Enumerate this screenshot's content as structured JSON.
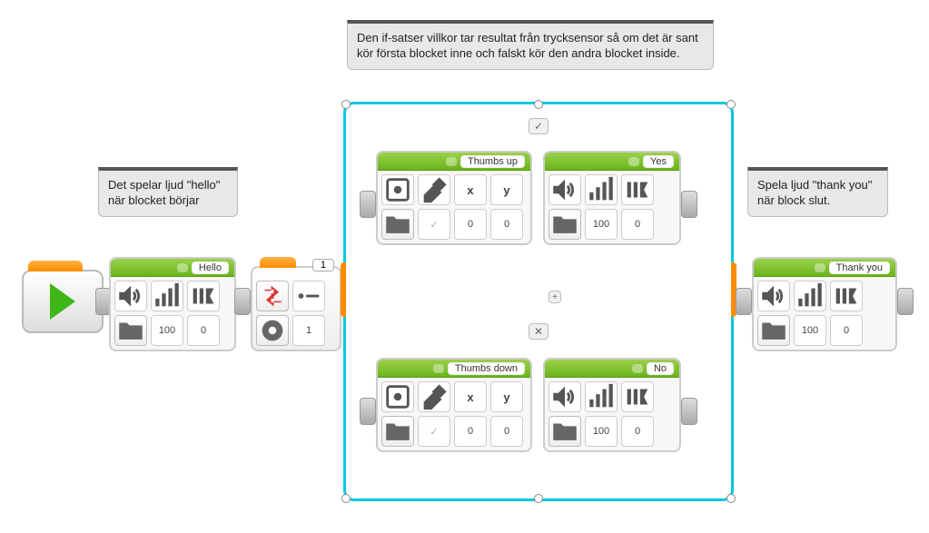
{
  "comments": {
    "left": "Det spelar ljud \"hello\" när blocket börjar",
    "top": "Den if-satser villkor tar resultat från trycksensor så om det är sant kör första blocket inne och falskt kör den andra blocket inside.",
    "right": "Spela ljud \"thank you\" när block slut."
  },
  "blocks": {
    "hello": {
      "label": "Hello",
      "volume": "100",
      "play_type": "0"
    },
    "thankyou": {
      "label": "Thank you",
      "volume": "100",
      "play_type": "0"
    },
    "sensor": {
      "port": "1",
      "state": "1"
    },
    "thumbs_up": {
      "label": "Thumbs up",
      "x": "0",
      "y": "0"
    },
    "yes": {
      "label": "Yes",
      "volume": "100",
      "play_type": "0"
    },
    "thumbs_down": {
      "label": "Thumbs down",
      "x": "0",
      "y": "0"
    },
    "no": {
      "label": "No",
      "volume": "100",
      "play_type": "0"
    }
  },
  "icons": {
    "check": "✓",
    "cross": "✕",
    "x_label": "x",
    "y_label": "y",
    "eraser": "⌫"
  }
}
